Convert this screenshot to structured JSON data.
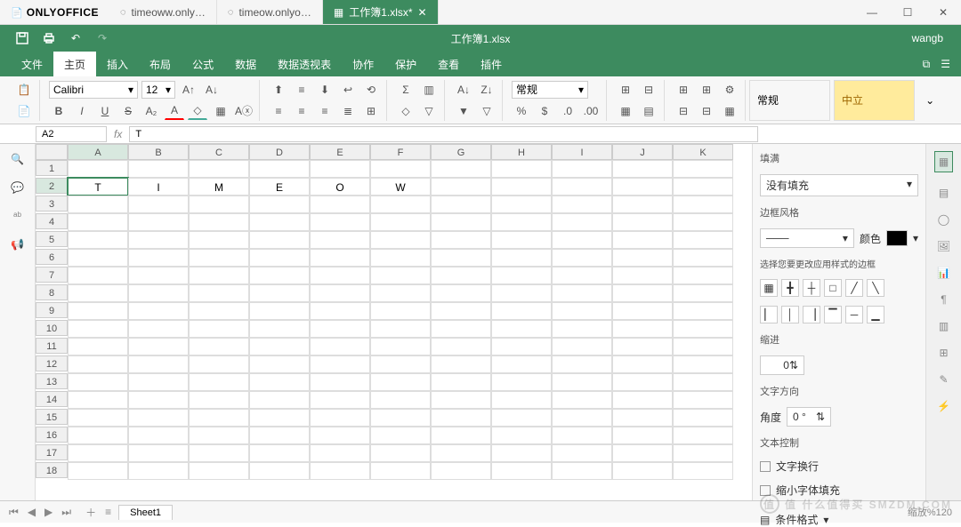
{
  "app": {
    "name": "ONLYOFFICE"
  },
  "tabs": [
    {
      "label": "timeoww.only…"
    },
    {
      "label": "timeow.onlyo…"
    },
    {
      "label": "工作簿1.xlsx*",
      "active": true
    }
  ],
  "doc_title": "工作簿1.xlsx",
  "user": "wangb",
  "menu": {
    "items": [
      "文件",
      "主页",
      "插入",
      "布局",
      "公式",
      "数据",
      "数据透视表",
      "协作",
      "保护",
      "查看",
      "插件"
    ],
    "active": "主页"
  },
  "ribbon": {
    "font_name": "Calibri",
    "font_size": "12",
    "number_format": "常规",
    "style_normal": "常规",
    "style_neutral": "中立"
  },
  "formula_bar": {
    "cell_ref": "A2",
    "fx": "fx",
    "value": "T"
  },
  "sheet": {
    "columns": [
      "A",
      "B",
      "C",
      "D",
      "E",
      "F",
      "G",
      "H",
      "I",
      "J",
      "K"
    ],
    "rows": [
      1,
      2,
      3,
      4,
      5,
      6,
      7,
      8,
      9,
      10,
      11,
      12,
      13,
      14,
      15,
      16,
      17,
      18
    ],
    "data_row": [
      "T",
      "I",
      "M",
      "E",
      "O",
      "W",
      "",
      "",
      "",
      "",
      ""
    ],
    "active_cell": "A2"
  },
  "panel": {
    "fill_label": "填满",
    "fill_value": "没有填充",
    "border_style_label": "边框风格",
    "color_label": "颜色",
    "border_hint": "选择您要更改应用样式的边框",
    "indent_label": "缩进",
    "indent_value": "0",
    "text_dir_label": "文字方向",
    "angle_label": "角度",
    "angle_value": "0 °",
    "text_ctrl_label": "文本控制",
    "wrap_label": "文字换行",
    "shrink_label": "缩小字体填充",
    "cond_format": "条件格式"
  },
  "status": {
    "sheet_name": "Sheet1",
    "zoom": "缩放%120"
  },
  "watermark": "值 什么值得买 SMZDM.COM"
}
